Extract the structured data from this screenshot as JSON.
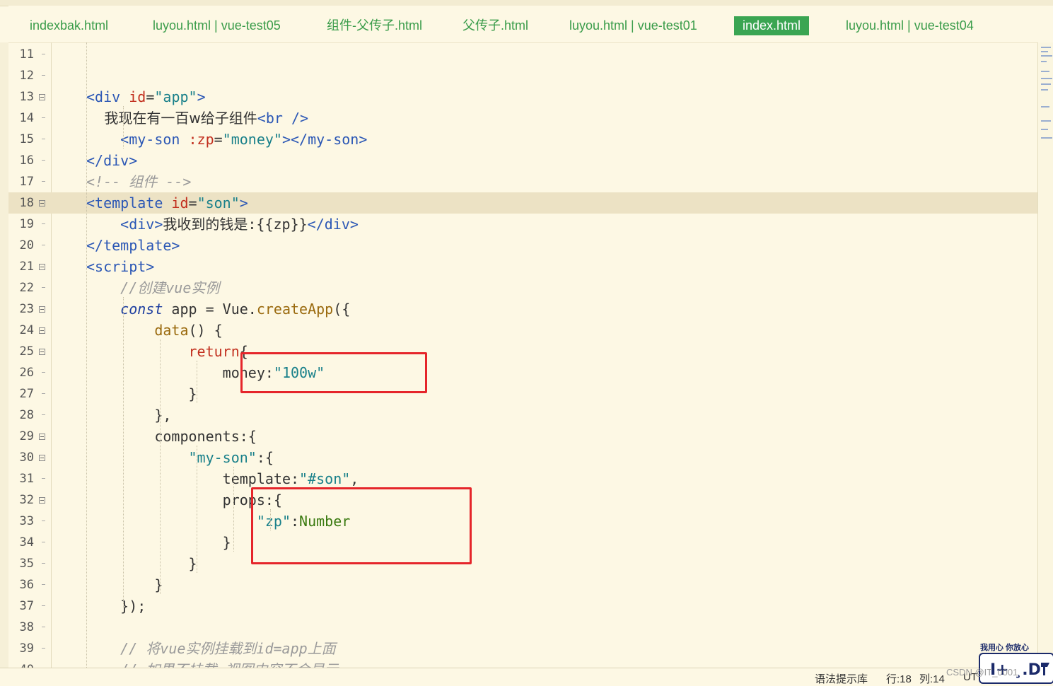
{
  "tabs": [
    {
      "label": "indexbak.html",
      "active": false
    },
    {
      "label": "luyou.html | vue-test05",
      "active": false
    },
    {
      "label": "组件-父传子.html",
      "active": false
    },
    {
      "label": "父传子.html",
      "active": false
    },
    {
      "label": "luyou.html | vue-test01",
      "active": false
    },
    {
      "label": "index.html",
      "active": true
    },
    {
      "label": "luyou.html | vue-test04",
      "active": false
    }
  ],
  "lines": [
    {
      "n": "11",
      "fold": false,
      "tokens": []
    },
    {
      "n": "12",
      "fold": false,
      "tokens": []
    },
    {
      "n": "13",
      "fold": true,
      "tokens": [
        [
          "t-tag",
          "<div "
        ],
        [
          "t-attr",
          "id"
        ],
        [
          "t-plain",
          "="
        ],
        [
          "t-val",
          "\"app\""
        ],
        [
          "t-tag",
          ">"
        ]
      ]
    },
    {
      "n": "14",
      "fold": false,
      "tokens": [
        [
          "t-cn",
          "    我现在有一百w给子组件"
        ],
        [
          "t-tag",
          "<br />"
        ]
      ]
    },
    {
      "n": "15",
      "fold": false,
      "tokens": [
        [
          "t-tag",
          "    <my-son "
        ],
        [
          "t-attr",
          ":zp"
        ],
        [
          "t-plain",
          "="
        ],
        [
          "t-val",
          "\"money\""
        ],
        [
          "t-tag",
          "></my-son>"
        ]
      ]
    },
    {
      "n": "16",
      "fold": false,
      "tokens": [
        [
          "t-tag",
          "</div>"
        ]
      ]
    },
    {
      "n": "17",
      "fold": false,
      "tokens": [
        [
          "t-comment",
          "<!-- 组件 -->"
        ]
      ]
    },
    {
      "n": "18",
      "fold": true,
      "current": true,
      "tokens": [
        [
          "t-tag",
          "<template "
        ],
        [
          "t-attr",
          "id"
        ],
        [
          "t-plain",
          "="
        ],
        [
          "t-val",
          "\"son\""
        ],
        [
          "t-tag",
          ">"
        ]
      ]
    },
    {
      "n": "19",
      "fold": false,
      "tokens": [
        [
          "t-tag",
          "    <div>"
        ],
        [
          "t-cn",
          "我收到的钱是"
        ],
        [
          "t-plain",
          ":{{zp}}"
        ],
        [
          "t-tag",
          "</div>"
        ]
      ]
    },
    {
      "n": "20",
      "fold": false,
      "tokens": [
        [
          "t-tag",
          "</template>"
        ]
      ]
    },
    {
      "n": "21",
      "fold": true,
      "tokens": [
        [
          "t-tag",
          "<script>"
        ]
      ]
    },
    {
      "n": "22",
      "fold": false,
      "tokens": [
        [
          "t-comment",
          "    //创建vue实例"
        ]
      ]
    },
    {
      "n": "23",
      "fold": true,
      "tokens": [
        [
          "t-kw",
          "    const "
        ],
        [
          "t-plain",
          "app = Vue."
        ],
        [
          "t-fn",
          "createApp"
        ],
        [
          "t-plain",
          "({"
        ]
      ]
    },
    {
      "n": "24",
      "fold": true,
      "tokens": [
        [
          "t-fn",
          "        data"
        ],
        [
          "t-plain",
          "() {"
        ]
      ]
    },
    {
      "n": "25",
      "fold": true,
      "tokens": [
        [
          "t-red",
          "            return"
        ],
        [
          "t-plain",
          "{"
        ]
      ]
    },
    {
      "n": "26",
      "fold": false,
      "tokens": [
        [
          "t-prop",
          "                money"
        ],
        [
          "t-plain",
          ":"
        ],
        [
          "t-val",
          "\"100w\""
        ]
      ]
    },
    {
      "n": "27",
      "fold": false,
      "tokens": [
        [
          "t-plain",
          "            }"
        ]
      ]
    },
    {
      "n": "28",
      "fold": false,
      "tokens": [
        [
          "t-plain",
          "        },"
        ]
      ]
    },
    {
      "n": "29",
      "fold": true,
      "tokens": [
        [
          "t-prop",
          "        components"
        ],
        [
          "t-plain",
          ":{"
        ]
      ]
    },
    {
      "n": "30",
      "fold": true,
      "tokens": [
        [
          "t-val",
          "            \"my-son\""
        ],
        [
          "t-plain",
          ":{"
        ]
      ]
    },
    {
      "n": "31",
      "fold": false,
      "tokens": [
        [
          "t-prop",
          "                template"
        ],
        [
          "t-plain",
          ":"
        ],
        [
          "t-val",
          "\"#son\""
        ],
        [
          "t-plain",
          ","
        ]
      ]
    },
    {
      "n": "32",
      "fold": true,
      "tokens": [
        [
          "t-prop",
          "                props"
        ],
        [
          "t-plain",
          ":{"
        ]
      ]
    },
    {
      "n": "33",
      "fold": false,
      "tokens": [
        [
          "t-val",
          "                    \"zp\""
        ],
        [
          "t-plain",
          ":"
        ],
        [
          "t-type",
          "Number"
        ]
      ]
    },
    {
      "n": "34",
      "fold": false,
      "tokens": [
        [
          "t-plain",
          "                }"
        ]
      ]
    },
    {
      "n": "35",
      "fold": false,
      "tokens": [
        [
          "t-plain",
          "            }"
        ]
      ]
    },
    {
      "n": "36",
      "fold": false,
      "tokens": [
        [
          "t-plain",
          "        }"
        ]
      ]
    },
    {
      "n": "37",
      "fold": false,
      "tokens": [
        [
          "t-plain",
          "    });"
        ]
      ]
    },
    {
      "n": "38",
      "fold": false,
      "tokens": []
    },
    {
      "n": "39",
      "fold": false,
      "tokens": [
        [
          "t-comment",
          "    // 将vue实例挂载到id=app上面"
        ]
      ]
    },
    {
      "n": "40",
      "fold": false,
      "tokens": [
        [
          "t-comment",
          "    // 如果不挂载 视图内容不会显示"
        ]
      ]
    }
  ],
  "status": {
    "syntax": "语法提示库",
    "line": "行:18",
    "col": "列:14",
    "encoding": "UT"
  },
  "watermark": "CSDN @IT_0001",
  "logo_slogan": "我用心 你放心",
  "colors": {
    "background": "#fdf8e4",
    "active_tab": "#3aa552",
    "highlight_box": "#e5252a"
  }
}
